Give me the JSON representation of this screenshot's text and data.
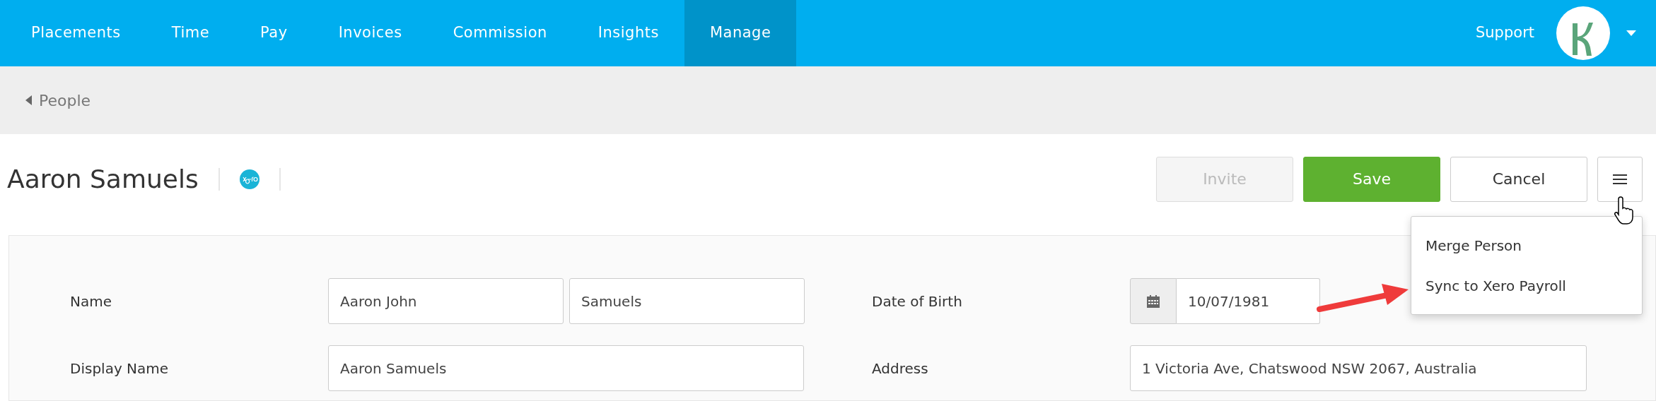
{
  "nav": {
    "items": [
      {
        "label": "Placements",
        "selected": false
      },
      {
        "label": "Time",
        "selected": false
      },
      {
        "label": "Pay",
        "selected": false
      },
      {
        "label": "Invoices",
        "selected": false
      },
      {
        "label": "Commission",
        "selected": false
      },
      {
        "label": "Insights",
        "selected": false
      },
      {
        "label": "Manage",
        "selected": true
      }
    ],
    "support": "Support"
  },
  "breadcrumb": {
    "label": "People"
  },
  "header": {
    "title": "Aaron Samuels",
    "actions": [
      {
        "label": "Invite",
        "disabled": true
      },
      {
        "label": "Save",
        "kind": "primary",
        "disabled": false
      },
      {
        "label": "Cancel",
        "kind": "default",
        "disabled": false
      }
    ]
  },
  "more_menu": {
    "expanded": true,
    "items": [
      {
        "label": "Merge Person"
      },
      {
        "label": "Sync to Xero Payroll"
      }
    ]
  },
  "form": {
    "left": [
      {
        "label": "Name",
        "values": [
          "Aaron John",
          "Samuels"
        ]
      },
      {
        "label": "Display Name",
        "values": [
          "Aaron Samuels"
        ]
      }
    ],
    "right": [
      {
        "label": "Date of Birth",
        "kind": "date",
        "values": [
          "10/07/1981"
        ]
      },
      {
        "label": "Address",
        "kind": "text",
        "values": [
          "1 Victoria Ave, Chatswood NSW 2067, Australia"
        ]
      }
    ]
  }
}
